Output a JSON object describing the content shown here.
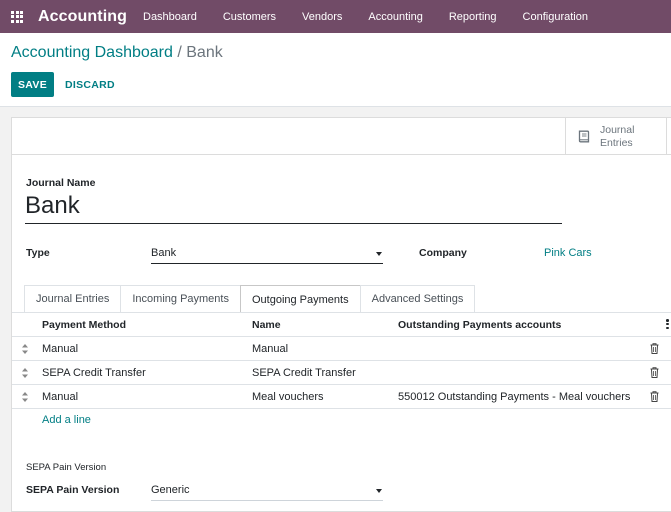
{
  "navbar": {
    "brand": "Accounting",
    "menu": [
      "Dashboard",
      "Customers",
      "Vendors",
      "Accounting",
      "Reporting",
      "Configuration"
    ]
  },
  "breadcrumb": {
    "parent": "Accounting Dashboard",
    "separator": "/",
    "current": "Bank"
  },
  "toolbar": {
    "save_label": "SAVE",
    "discard_label": "DISCARD"
  },
  "smart_button": {
    "line1": "Journal",
    "line2": "Entries",
    "icon": "book-icon"
  },
  "form": {
    "journal_name_label": "Journal Name",
    "journal_name": "Bank",
    "type_label": "Type",
    "type_value": "Bank",
    "company_label": "Company",
    "company_value": "Pink Cars"
  },
  "tabs": [
    {
      "label": "Journal Entries",
      "active": false
    },
    {
      "label": "Incoming Payments",
      "active": false
    },
    {
      "label": "Outgoing Payments",
      "active": true
    },
    {
      "label": "Advanced Settings",
      "active": false
    }
  ],
  "table": {
    "columns": [
      "Payment Method",
      "Name",
      "Outstanding Payments accounts"
    ],
    "rows": [
      {
        "method": "Manual",
        "name": "Manual",
        "account": ""
      },
      {
        "method": "SEPA Credit Transfer",
        "name": "SEPA Credit Transfer",
        "account": ""
      },
      {
        "method": "Manual",
        "name": "Meal vouchers",
        "account": "550012 Outstanding Payments - Meal vouchers"
      }
    ],
    "add_line": "Add a line"
  },
  "sepa": {
    "section_title": "SEPA Pain Version",
    "field_label": "SEPA Pain Version",
    "value": "Generic"
  },
  "colors": {
    "navbar": "#714b67",
    "primary": "#017e84"
  }
}
